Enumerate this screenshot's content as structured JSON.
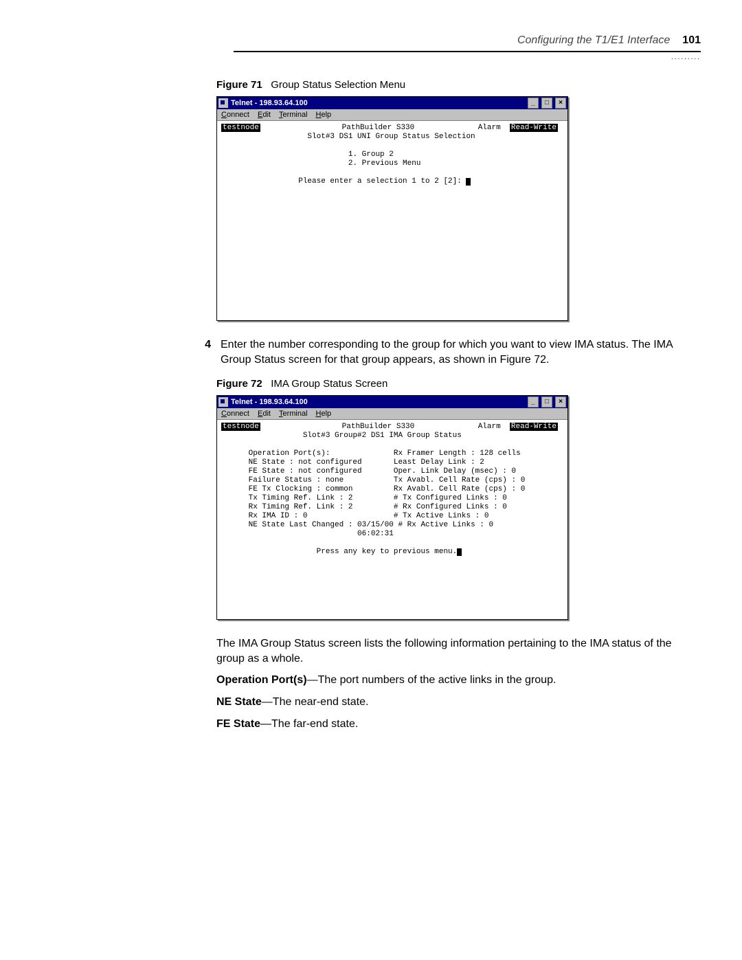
{
  "header": {
    "section_title": "Configuring the T1/E1 Interface",
    "page_number": "101",
    "dots": "........."
  },
  "figure71": {
    "label": "Figure 71",
    "caption": "Group Status Selection Menu"
  },
  "telnet1": {
    "title": "Telnet - 198.93.64.100",
    "menus": {
      "connect": "Connect",
      "edit": "Edit",
      "terminal": "Terminal",
      "help": "Help"
    },
    "hostname": "testnode",
    "sys_title": "PathBuilder S330",
    "alarm": "Alarm",
    "mode": "Read-Write",
    "subtitle": "Slot#3 DS1 UNI Group Status Selection",
    "opt1": "1. Group 2",
    "opt2": "2. Previous Menu",
    "prompt": "Please enter a selection 1 to 2 [2]: "
  },
  "step4": {
    "num": "4",
    "text": "Enter the number corresponding to the group for which you want to view IMA status. The IMA Group Status screen for that group appears, as shown in Figure 72."
  },
  "figure72": {
    "label": "Figure 72",
    "caption": "IMA Group Status Screen"
  },
  "telnet2": {
    "title": "Telnet - 198.93.64.100",
    "hostname": "testnode",
    "sys_title": "PathBuilder S330",
    "alarm": "Alarm",
    "mode": "Read-Write",
    "subtitle": "Slot#3 Group#2 DS1 IMA Group Status",
    "left": {
      "l1": "Operation Port(s):",
      "l2": "NE State : not configured",
      "l3": "FE State : not configured",
      "l4": "Failure Status : none",
      "l5": "FE Tx Clocking : common",
      "l6": "Tx Timing Ref. Link : 2",
      "l7": "Rx Timing Ref. Link : 2",
      "l8": "Rx IMA ID : 0",
      "l9a": "NE State Last Changed : 03/15/00",
      "l9b": "06:02:31"
    },
    "right": {
      "r1": "Rx Framer Length : 128 cells",
      "r2": "Least Delay Link : 2",
      "r3": "Oper. Link Delay (msec) : 0",
      "r4": "Tx Avabl. Cell Rate (cps) : 0",
      "r5": "Rx Avabl. Cell Rate (cps) : 0",
      "r6": "# Tx Configured Links : 0",
      "r7": "# Rx Configured Links : 0",
      "r8": "# Tx Active Links : 0",
      "r9": "# Rx Active Links : 0"
    },
    "footer": "Press any key to previous menu."
  },
  "tail": {
    "p1": "The IMA Group Status screen lists the following information pertaining to the IMA status of the group as a whole.",
    "p2a": "Operation Port(s)",
    "p2b": "—The port numbers of the active links in the group.",
    "p3a": "NE State",
    "p3b": "—The near-end state.",
    "p4a": "FE State",
    "p4b": "—The far-end state."
  }
}
